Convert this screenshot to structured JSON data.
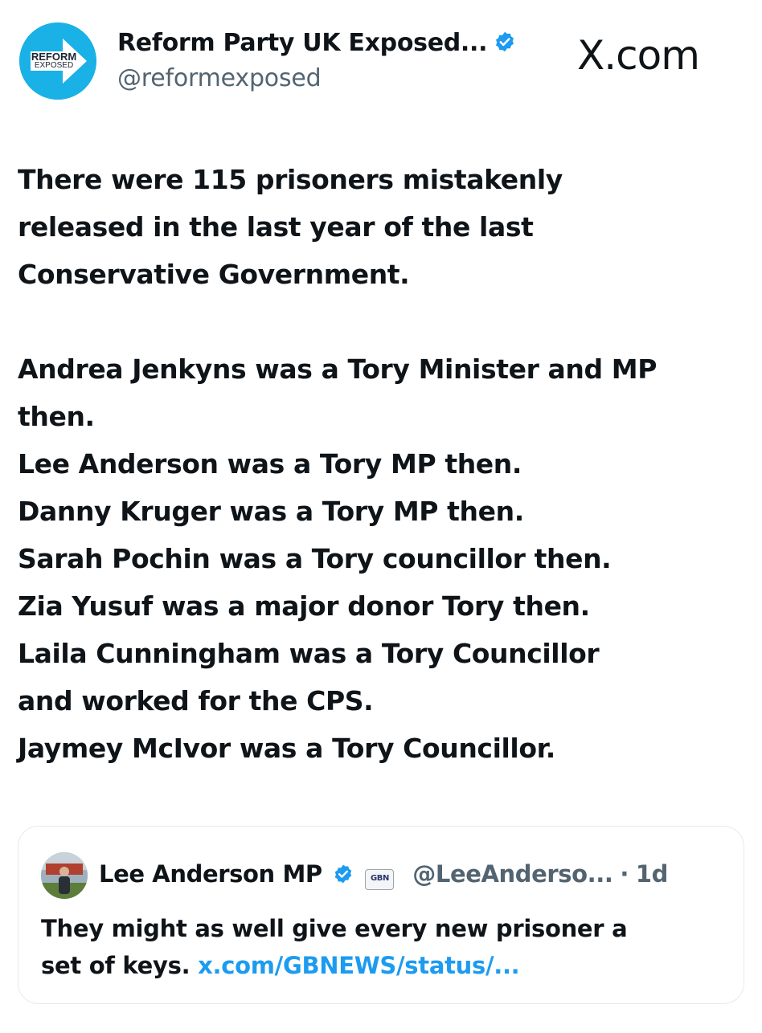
{
  "author": {
    "display_name": "Reform Party UK Exposed...",
    "handle": "@reformexposed",
    "avatar_text_top": "REFORM",
    "avatar_text_bottom": "EXPOSED",
    "verified": true,
    "verified_icon": "verified-badge-icon"
  },
  "site_mark": "X.com",
  "tweet": {
    "paragraph1": [
      "There were 115 prisoners mistakenly",
      "released in the last year of the last",
      "Conservative Government."
    ],
    "paragraph2": [
      "Andrea Jenkyns was a Tory Minister and MP",
      "then.",
      "Lee Anderson was a Tory MP then.",
      "Danny Kruger was a Tory MP then.",
      "Sarah Pochin was a Tory councillor then.",
      "Zia Yusuf was a major donor Tory then.",
      "Laila Cunningham was a Tory Councillor",
      "and worked for the CPS.",
      "Jaymey McIvor was a Tory Councillor."
    ]
  },
  "quote": {
    "display_name": "Lee Anderson MP",
    "affiliation_badge": "GBN",
    "handle": "@LeeAnderso...",
    "separator": "·",
    "time": "1d",
    "text": "They might as well give every new prisoner a",
    "text_line2": "set of keys.",
    "link": "x.com/GBNEWS/status/..."
  },
  "colors": {
    "text": "#0f1419",
    "secondary": "#536471",
    "link": "#1d9bf0",
    "verified": "#1d9bf0",
    "avatar_bg": "#19b1e6"
  }
}
